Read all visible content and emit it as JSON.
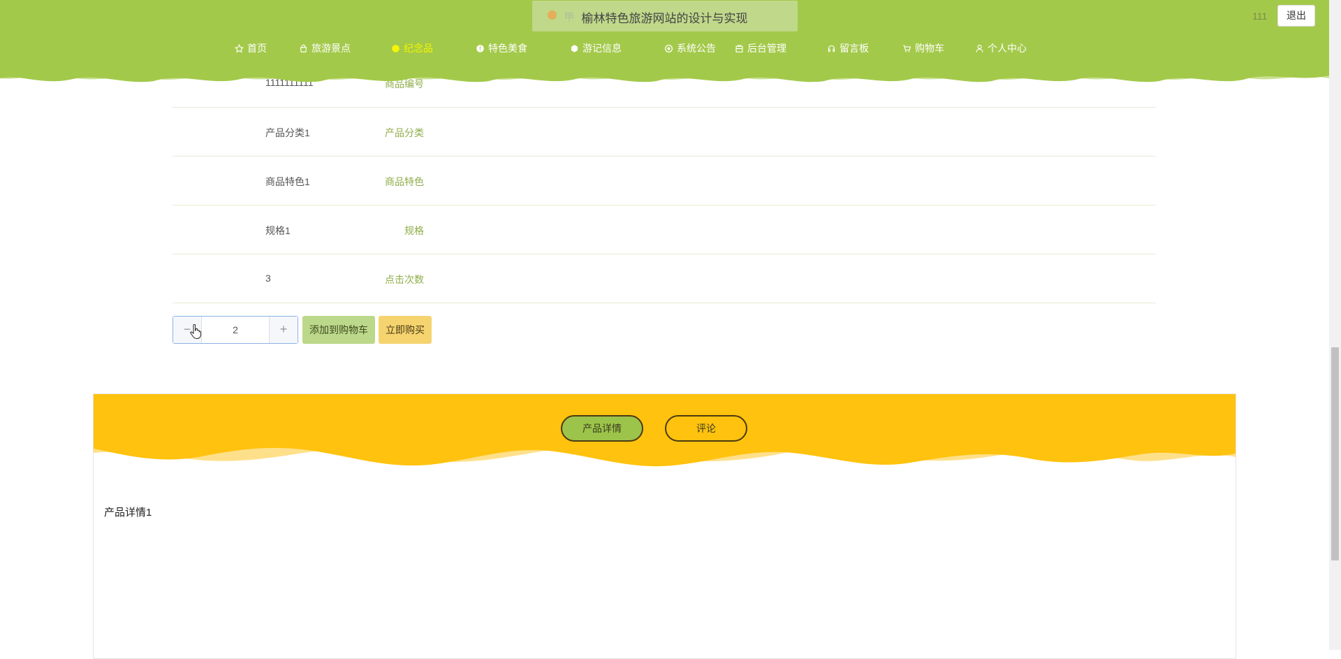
{
  "header": {
    "site_title": "榆林特色旅游网站的设计与实现",
    "toast_text": "甲",
    "user_name": "111",
    "logout_label": "退出",
    "bg_color": "#a3c94a",
    "nav": [
      {
        "label": "首页",
        "icon": "star-icon"
      },
      {
        "label": "旅游景点",
        "icon": "bag-icon"
      },
      {
        "label": "纪念品",
        "icon": "circle-icon",
        "active": true
      },
      {
        "label": "特色美食",
        "icon": "info-circle-icon"
      },
      {
        "label": "游记信息",
        "icon": "hexagon-icon"
      },
      {
        "label": "系统公告",
        "icon": "settings-icon"
      },
      {
        "label": "后台管理",
        "icon": "box-icon"
      },
      {
        "label": "留言板",
        "icon": "headset-icon"
      },
      {
        "label": "购物车",
        "icon": "cart-icon"
      },
      {
        "label": "个人中心",
        "icon": "user-icon"
      }
    ]
  },
  "details": [
    {
      "label": "商品编号",
      "value": "1111111111"
    },
    {
      "label": "产品分类",
      "value": "产品分类1"
    },
    {
      "label": "商品特色",
      "value": "商品特色1"
    },
    {
      "label": "规格",
      "value": "规格1"
    },
    {
      "label": "点击次数",
      "value": "3"
    }
  ],
  "purchase": {
    "minus": "−",
    "quantity": "2",
    "plus": "+",
    "add_to_cart": "添加到购物车",
    "buy_now": "立即购买"
  },
  "tabs": {
    "detail": "产品详情",
    "comment": "评论",
    "active": "detail",
    "panel_color": "#ffc20e",
    "content": "产品详情1"
  }
}
